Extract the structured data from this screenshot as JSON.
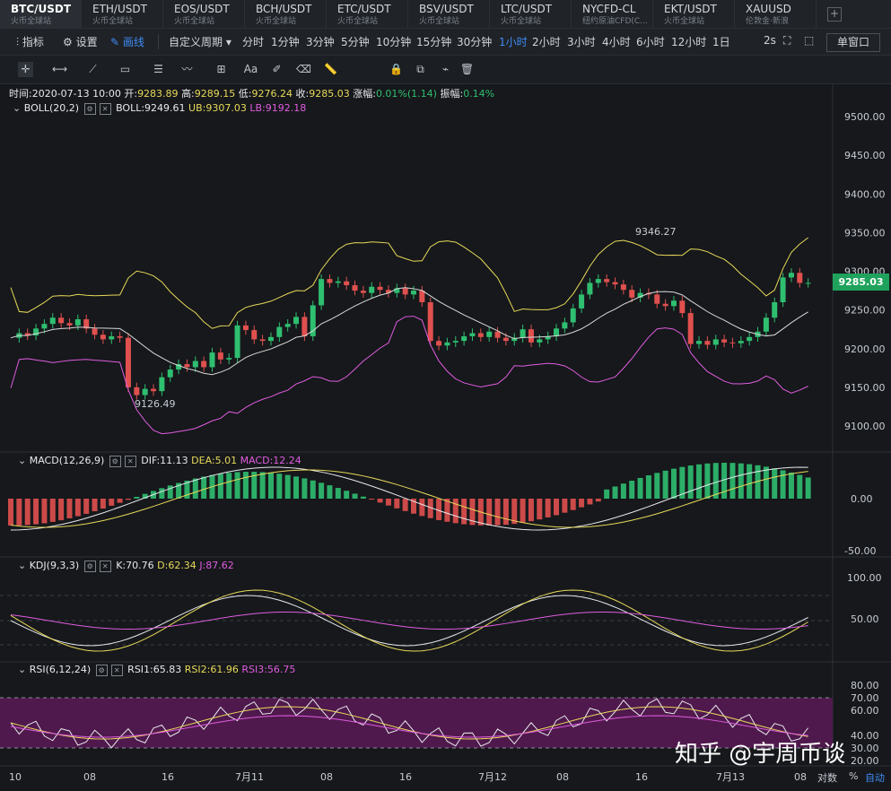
{
  "tabs": [
    {
      "symbol": "BTC/USDT",
      "sub": "火币全球站"
    },
    {
      "symbol": "ETH/USDT",
      "sub": "火币全球站"
    },
    {
      "symbol": "EOS/USDT",
      "sub": "火币全球站"
    },
    {
      "symbol": "BCH/USDT",
      "sub": "火币全球站"
    },
    {
      "symbol": "ETC/USDT",
      "sub": "火币全球站"
    },
    {
      "symbol": "BSV/USDT",
      "sub": "火币全球站"
    },
    {
      "symbol": "LTC/USDT",
      "sub": "火币全球站"
    },
    {
      "symbol": "NYCFD-CL",
      "sub": "纽约原油CFD(C..."
    },
    {
      "symbol": "EKT/USDT",
      "sub": "火币全球站"
    },
    {
      "symbol": "XAUUSD",
      "sub": "伦敦金·新浪"
    }
  ],
  "add_tab": "+",
  "toolbar": {
    "indicator": "指标",
    "settings": "设置",
    "draw": "画线",
    "custom_period": "自定义周期",
    "periods": [
      "分时",
      "1分钟",
      "3分钟",
      "5分钟",
      "10分钟",
      "15分钟",
      "30分钟",
      "1小时",
      "2小时",
      "3小时",
      "4小时",
      "6小时",
      "12小时",
      "1日"
    ],
    "active_period": "1小时",
    "refresh": "2s",
    "window_mode": "单窗口"
  },
  "draw_tools": [
    "crosshair",
    "horizontal-line",
    "trend-line",
    "rectangle",
    "parallel-lines",
    "wave",
    "fibonacci",
    "text",
    "brush",
    "eraser",
    "ruler",
    "lock",
    "copy",
    "magnet",
    "trash"
  ],
  "text_tool_label": "Aa",
  "ohlc": {
    "time_label": "时间:",
    "time": "2020-07-13 10:00",
    "open_label": "开:",
    "open": "9283.89",
    "high_label": "高:",
    "high": "9289.15",
    "low_label": "低:",
    "low": "9276.24",
    "close_label": "收:",
    "close": "9285.03",
    "change_label": "涨幅:",
    "change": "0.01%(1.14)",
    "amp_label": "振幅:",
    "amp": "0.14%"
  },
  "boll": {
    "name": "BOLL(20,2)",
    "mid": "BOLL:9249.61",
    "ub": "UB:9307.03",
    "lb": "LB:9192.18"
  },
  "macd": {
    "name": "MACD(12,26,9)",
    "dif": "DIF:11.13",
    "dea": "DEA:5.01",
    "macd": "MACD:12.24"
  },
  "kdj": {
    "name": "KDJ(9,3,3)",
    "k": "K:70.76",
    "d": "D:62.34",
    "j": "J:87.62"
  },
  "rsi": {
    "name": "RSI(6,12,24)",
    "r1": "RSI1:65.83",
    "r2": "RSI2:61.96",
    "r3": "RSI3:56.75"
  },
  "price_axis": [
    "9500.00",
    "9450.00",
    "9400.00",
    "9350.00",
    "9300.00",
    "9250.00",
    "9200.00",
    "9150.00",
    "9100.00"
  ],
  "macd_axis": [
    "0.00",
    "-50.00"
  ],
  "kdj_axis": [
    "100.00",
    "50.00"
  ],
  "rsi_axis": [
    "80.00",
    "70.00",
    "60.00",
    "40.00",
    "30.00",
    "20.00"
  ],
  "last_price": "9285.03",
  "high_marker": "9346.27",
  "low_marker": "9126.49",
  "time_axis": [
    "10",
    "08",
    "16",
    "7月11",
    "08",
    "16",
    "7月12",
    "08",
    "16",
    "7月13",
    "08"
  ],
  "axis_buttons": {
    "log": "对数",
    "pct": "%",
    "auto": "自动"
  },
  "watermark": "知乎 @宇周币谈",
  "colors": {
    "up": "#2fbf71",
    "down": "#e0504f",
    "boll_mid": "#d9d9d9",
    "boll_ub": "#e8d95a",
    "boll_lb": "#e05ce0",
    "accent": "#3f8cf5"
  }
}
